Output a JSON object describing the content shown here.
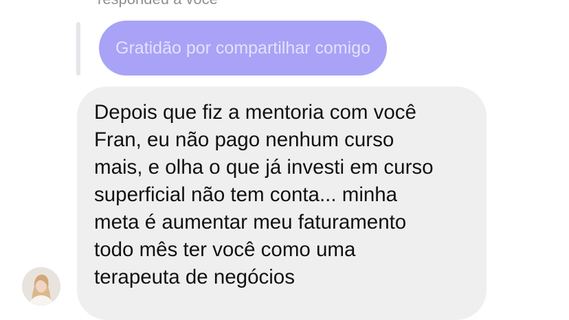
{
  "reply": {
    "header": "respondeu a você",
    "quoted_message": "Gratidão por compartilhar comigo"
  },
  "message": {
    "lines": [
      "Depois que fiz a mentoria com você",
      "Fran, eu não pago nenhum curso",
      "mais, e olha o que já investi em curso",
      "superficial não tem conta... minha",
      "meta é aumentar meu faturamento",
      "todo mês ter você como uma",
      "terapeuta de negócios"
    ]
  },
  "sender": {
    "avatar_icon": "profile-photo"
  },
  "colors": {
    "quoted_bubble": "#a8a3f6",
    "quoted_text": "#e4e1ff",
    "message_bubble": "#efefef",
    "reply_bar": "#e5e5ea"
  }
}
